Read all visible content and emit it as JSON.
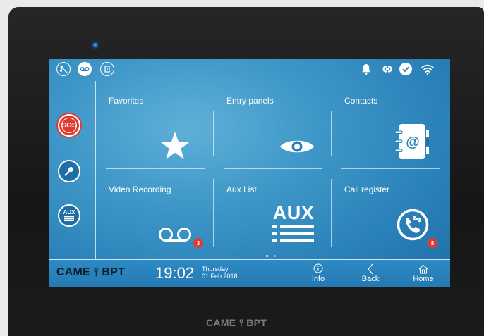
{
  "bezel": {
    "logo": "CAME ⫯ BPT"
  },
  "topbar": {
    "left_icons": [
      "mute-icon",
      "voicemail-icon",
      "door-icon"
    ],
    "right_icons": [
      "bell-icon",
      "link-icon",
      "check-icon",
      "wifi-icon"
    ]
  },
  "sidebar": {
    "sos_label": "SOS",
    "aux_label": "AUX"
  },
  "tiles": [
    {
      "label": "Favorites",
      "icon": "star-icon"
    },
    {
      "label": "Entry panels",
      "icon": "eye-icon"
    },
    {
      "label": "Contacts",
      "icon": "address-book-icon"
    },
    {
      "label": "Video Recording",
      "icon": "voicemail-icon",
      "badge": "3"
    },
    {
      "label": "Aux List",
      "icon": "aux-icon",
      "icon_text": "AUX"
    },
    {
      "label": "Call register",
      "icon": "call-register-icon",
      "badge": "8"
    }
  ],
  "pager": {
    "pages": 2,
    "active": 1
  },
  "bottombar": {
    "brand": "CAME ⫯ BPT",
    "time": "19:02",
    "weekday": "Thursday",
    "date": "01 Feb 2018",
    "nav": [
      {
        "label": "Info",
        "icon": "info-icon"
      },
      {
        "label": "Back",
        "icon": "chevron-left-icon"
      },
      {
        "label": "Home",
        "icon": "home-icon"
      }
    ]
  },
  "colors": {
    "accent_red": "#e03b2f",
    "screen_blue": "#3e97c8",
    "bezel": "#1b1b1c"
  }
}
